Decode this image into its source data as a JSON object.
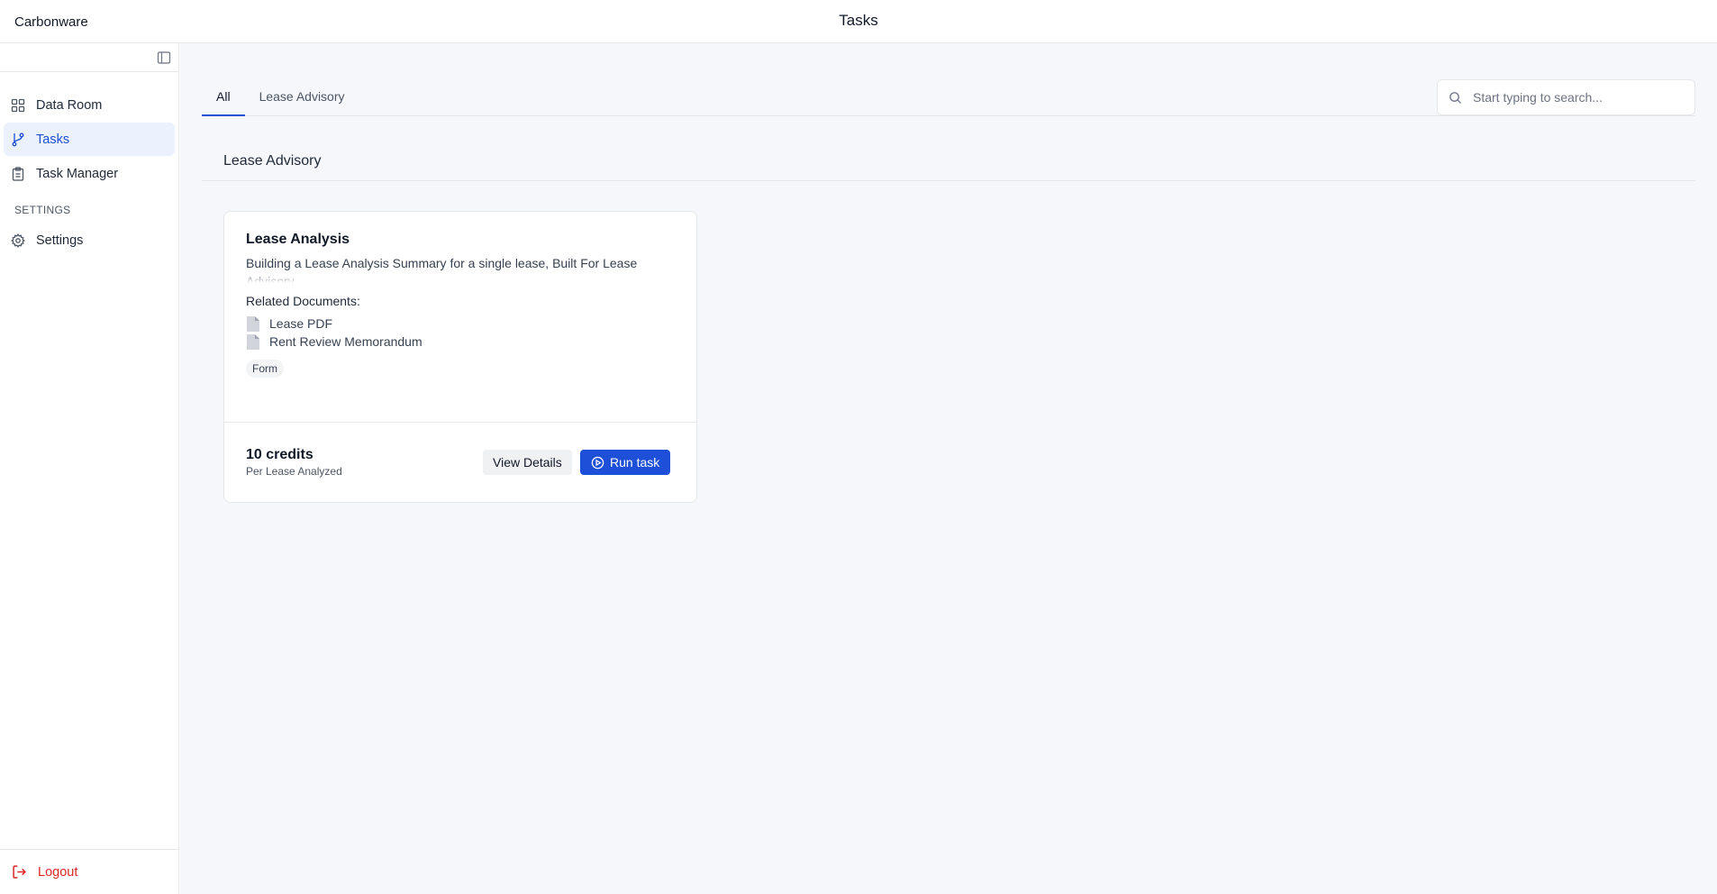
{
  "header": {
    "brand": "Carbonware",
    "title": "Tasks"
  },
  "sidebar": {
    "items": [
      {
        "label": "Data Room",
        "icon": "grid-icon"
      },
      {
        "label": "Tasks",
        "icon": "git-branch-icon",
        "active": true
      },
      {
        "label": "Task Manager",
        "icon": "clipboard-icon"
      }
    ],
    "settings_heading": "SETTINGS",
    "settings_item": {
      "label": "Settings",
      "icon": "gear-icon"
    },
    "logout_label": "Logout"
  },
  "tabs": [
    {
      "label": "All",
      "active": true
    },
    {
      "label": "Lease Advisory",
      "active": false
    }
  ],
  "search": {
    "placeholder": "Start typing to search...",
    "value": ""
  },
  "section": {
    "title": "Lease Advisory"
  },
  "card": {
    "title": "Lease Analysis",
    "description": "Building a Lease Analysis Summary for a single lease, Built For Lease Advisory.",
    "related_label": "Related Documents:",
    "documents": [
      "Lease PDF",
      "Rent Review Memorandum"
    ],
    "tag": "Form",
    "credits": "10 credits",
    "credits_sub": "Per Lease Analyzed",
    "view_details_label": "View Details",
    "run_label": "Run task"
  },
  "colors": {
    "accent": "#1d4fd8",
    "active_bg": "#ebf1fd",
    "danger": "#dc2626",
    "main_bg": "#f6f7fb"
  }
}
